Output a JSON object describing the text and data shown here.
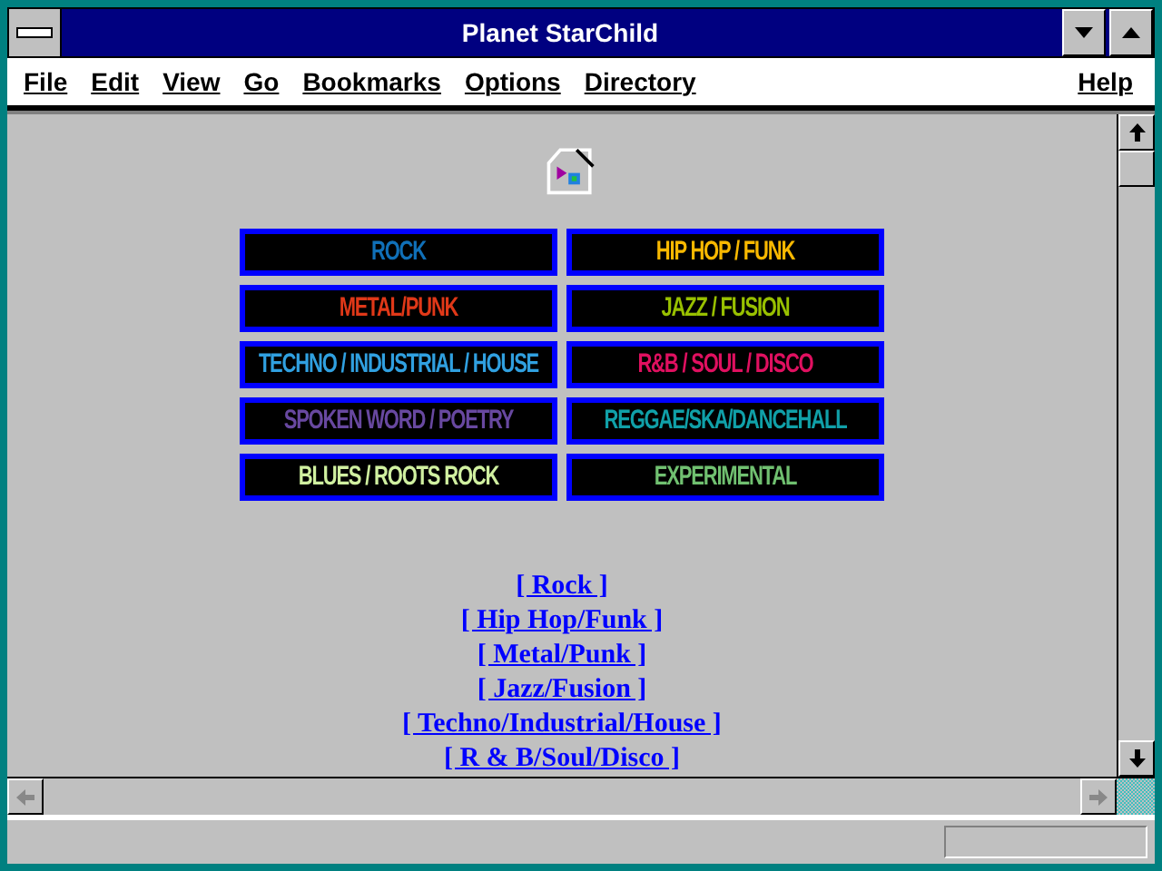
{
  "window": {
    "title": "Planet StarChild"
  },
  "menu": [
    "File",
    "Edit",
    "View",
    "Go",
    "Bookmarks",
    "Options",
    "Directory"
  ],
  "help_menu": "Help",
  "genres": [
    {
      "label": "ROCK",
      "color": "#1070b8"
    },
    {
      "label": "HIP HOP / FUNK",
      "color": "#f8b800"
    },
    {
      "label": "METAL/PUNK",
      "color": "#e03818"
    },
    {
      "label": "JAZZ / FUSION",
      "color": "#98c000"
    },
    {
      "label": "TECHNO / INDUSTRIAL / HOUSE",
      "color": "#30a0e0"
    },
    {
      "label": "R&B / SOUL / DISCO",
      "color": "#e01060"
    },
    {
      "label": "SPOKEN WORD / POETRY",
      "color": "#6848a0"
    },
    {
      "label": "REGGAE/SKA/DANCEHALL",
      "color": "#10a0a8"
    },
    {
      "label": "BLUES / ROOTS ROCK",
      "color": "#d0f0a0"
    },
    {
      "label": "EXPERIMENTAL",
      "color": "#70c070"
    }
  ],
  "links": [
    "[ Rock ]",
    "[ Hip Hop/Funk ]",
    "[ Metal/Punk ]",
    "[ Jazz/Fusion ]",
    "[ Techno/Industrial/House ]",
    "[ R & B/Soul/Disco ]"
  ]
}
